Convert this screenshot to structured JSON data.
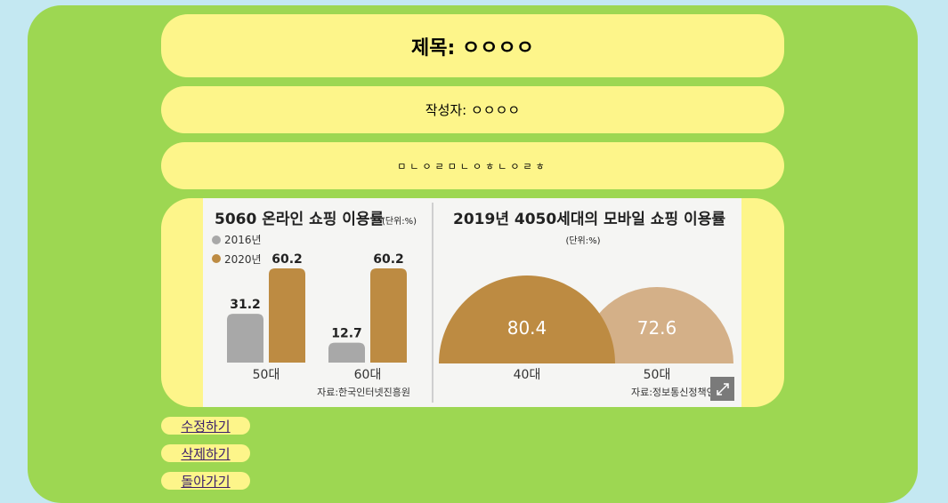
{
  "post": {
    "title": "제목: ㅇㅇㅇㅇ",
    "author": "작성자: ㅇㅇㅇㅇ",
    "content": "ㅁㄴㅇㄹㅁㄴㅇㅎㄴㅇㄹㅎ"
  },
  "infographic": {
    "left": {
      "title": "5060 온라인 쇼핑 이용률",
      "unit": "(단위:%)",
      "legend": [
        "2016년",
        "2020년"
      ],
      "source": "자료:한국인터넷진흥원"
    },
    "right": {
      "title": "2019년 4050세대의 모바일 쇼핑 이용률",
      "unit": "(단위:%)",
      "source": "자료:정보통신정책연구원"
    },
    "colors": {
      "gray": "#a8a8a8",
      "gold": "#bd8b42",
      "tan": "#d4b088"
    }
  },
  "chart_data": [
    {
      "type": "bar",
      "title": "5060 온라인 쇼핑 이용률",
      "categories": [
        "50대",
        "60대"
      ],
      "series": [
        {
          "name": "2016년",
          "values": [
            31.2,
            12.7
          ]
        },
        {
          "name": "2020년",
          "values": [
            60.2,
            60.2
          ]
        }
      ],
      "ylim": [
        0,
        60.2
      ],
      "legend": "top-left"
    },
    {
      "type": "pie",
      "title": "2019년 4050세대의 모바일 쇼핑 이용률",
      "categories": [
        "40대",
        "50대"
      ],
      "values": [
        80.4,
        72.6
      ]
    }
  ],
  "actions": {
    "edit": "수정하기",
    "delete": "삭제하기",
    "back": "돌아가기"
  }
}
